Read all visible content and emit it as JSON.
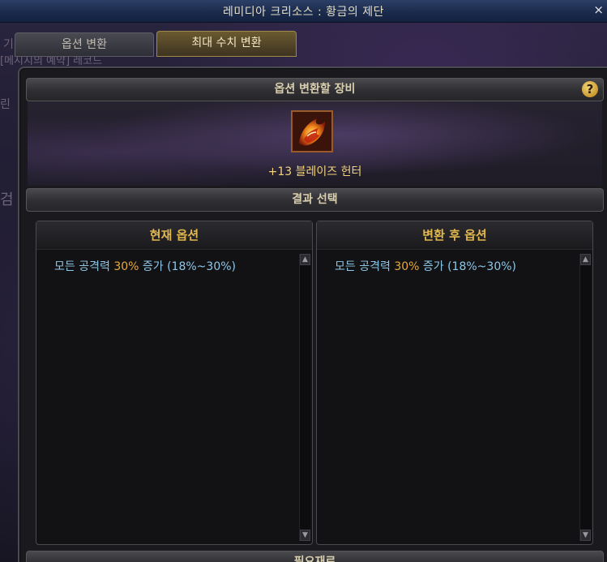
{
  "window": {
    "title": "레미디아 크리소스 : 황금의 제단",
    "close_glyph": "×"
  },
  "tabs": [
    {
      "label": "옵션 변환",
      "active": false
    },
    {
      "label": "최대 수치 변환",
      "active": true
    }
  ],
  "background_fragments": [
    "기",
    "[메시지의 예약] 레코드",
    "린",
    "검"
  ],
  "equip_section": {
    "title": "옵션 변환할 장비",
    "help_glyph": "?",
    "item_name": "+13 블레이즈 헌터",
    "item_icon": "blaze-hunter-icon"
  },
  "result_section": {
    "title": "결과 선택",
    "current": {
      "header": "현재 옵션",
      "line_prefix": "모든 공격력 ",
      "line_value": "30%",
      "line_suffix": " 증가 (18%~30%)"
    },
    "converted": {
      "header": "변환 후 옵션",
      "line_prefix": "모든 공격력 ",
      "line_value": "30%",
      "line_suffix": " 증가 (18%~30%)"
    }
  },
  "materials_section": {
    "title": "필요재료"
  },
  "colors": {
    "header_gold": "#e2b84e",
    "option_text": "#8ec7e8",
    "option_highlight": "#e8a93a",
    "item_name": "#f2d27a"
  }
}
